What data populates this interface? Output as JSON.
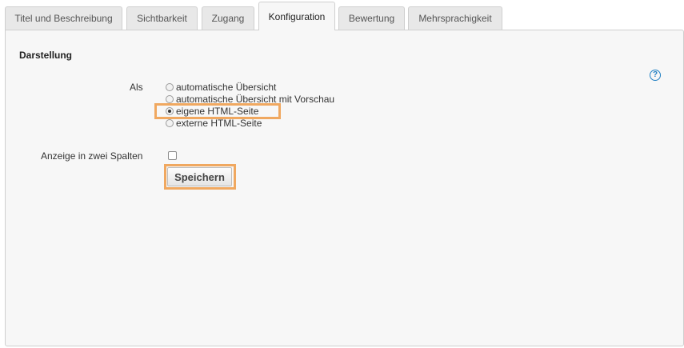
{
  "tabs": [
    {
      "label": "Titel und Beschreibung",
      "active": false
    },
    {
      "label": "Sichtbarkeit",
      "active": false
    },
    {
      "label": "Zugang",
      "active": false
    },
    {
      "label": "Konfiguration",
      "active": true
    },
    {
      "label": "Bewertung",
      "active": false
    },
    {
      "label": "Mehrsprachigkeit",
      "active": false
    }
  ],
  "section": {
    "title": "Darstellung",
    "help_icon": "help-circle-icon",
    "help_glyph": "?"
  },
  "display_as": {
    "label": "Als",
    "options": [
      {
        "label": "automatische Übersicht",
        "checked": false
      },
      {
        "label": "automatische Übersicht mit Vorschau",
        "checked": false
      },
      {
        "label": "eigene HTML-Seite",
        "checked": true
      },
      {
        "label": "externe HTML-Seite",
        "checked": false
      }
    ]
  },
  "two_columns": {
    "label": "Anzeige in zwei Spalten",
    "checked": false
  },
  "save_label": "Speichern",
  "colors": {
    "highlight": "#f0a860",
    "help": "#1f7fc2",
    "panel": "#f7f7f7",
    "tab": "#e8e8e8"
  }
}
